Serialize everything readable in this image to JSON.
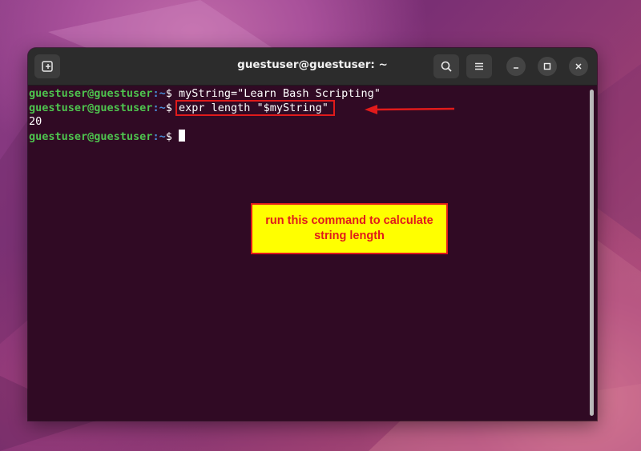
{
  "window": {
    "title": "guestuser@guestuser: ~"
  },
  "titlebar": {
    "new_tab_icon": "new-tab-icon",
    "search_icon": "search-icon",
    "menu_icon": "hamburger-menu-icon",
    "minimize_icon": "minimize-icon",
    "maximize_icon": "maximize-icon",
    "close_icon": "close-icon"
  },
  "terminal": {
    "lines": [
      {
        "user_host": "guestuser@guestuser",
        "path": ":~",
        "dollar": "$ ",
        "command": "myString=\"Learn Bash Scripting\""
      },
      {
        "user_host": "guestuser@guestuser",
        "path": ":~",
        "dollar": "$ ",
        "command": "expr length \"$myString\""
      },
      {
        "output": "20"
      },
      {
        "user_host": "guestuser@guestuser",
        "path": ":~",
        "dollar": "$ ",
        "command": ""
      }
    ]
  },
  "annotation": {
    "note_text": "run this command to calculate string length",
    "colors": {
      "note_background": "#ffff00",
      "note_text": "#e01b1b",
      "highlight_border": "#e01b1b"
    }
  },
  "colors": {
    "terminal_background": "#300a24",
    "prompt_user": "#4ec34e",
    "prompt_path": "#4a8ed8",
    "titlebar": "#2c2c2c"
  }
}
